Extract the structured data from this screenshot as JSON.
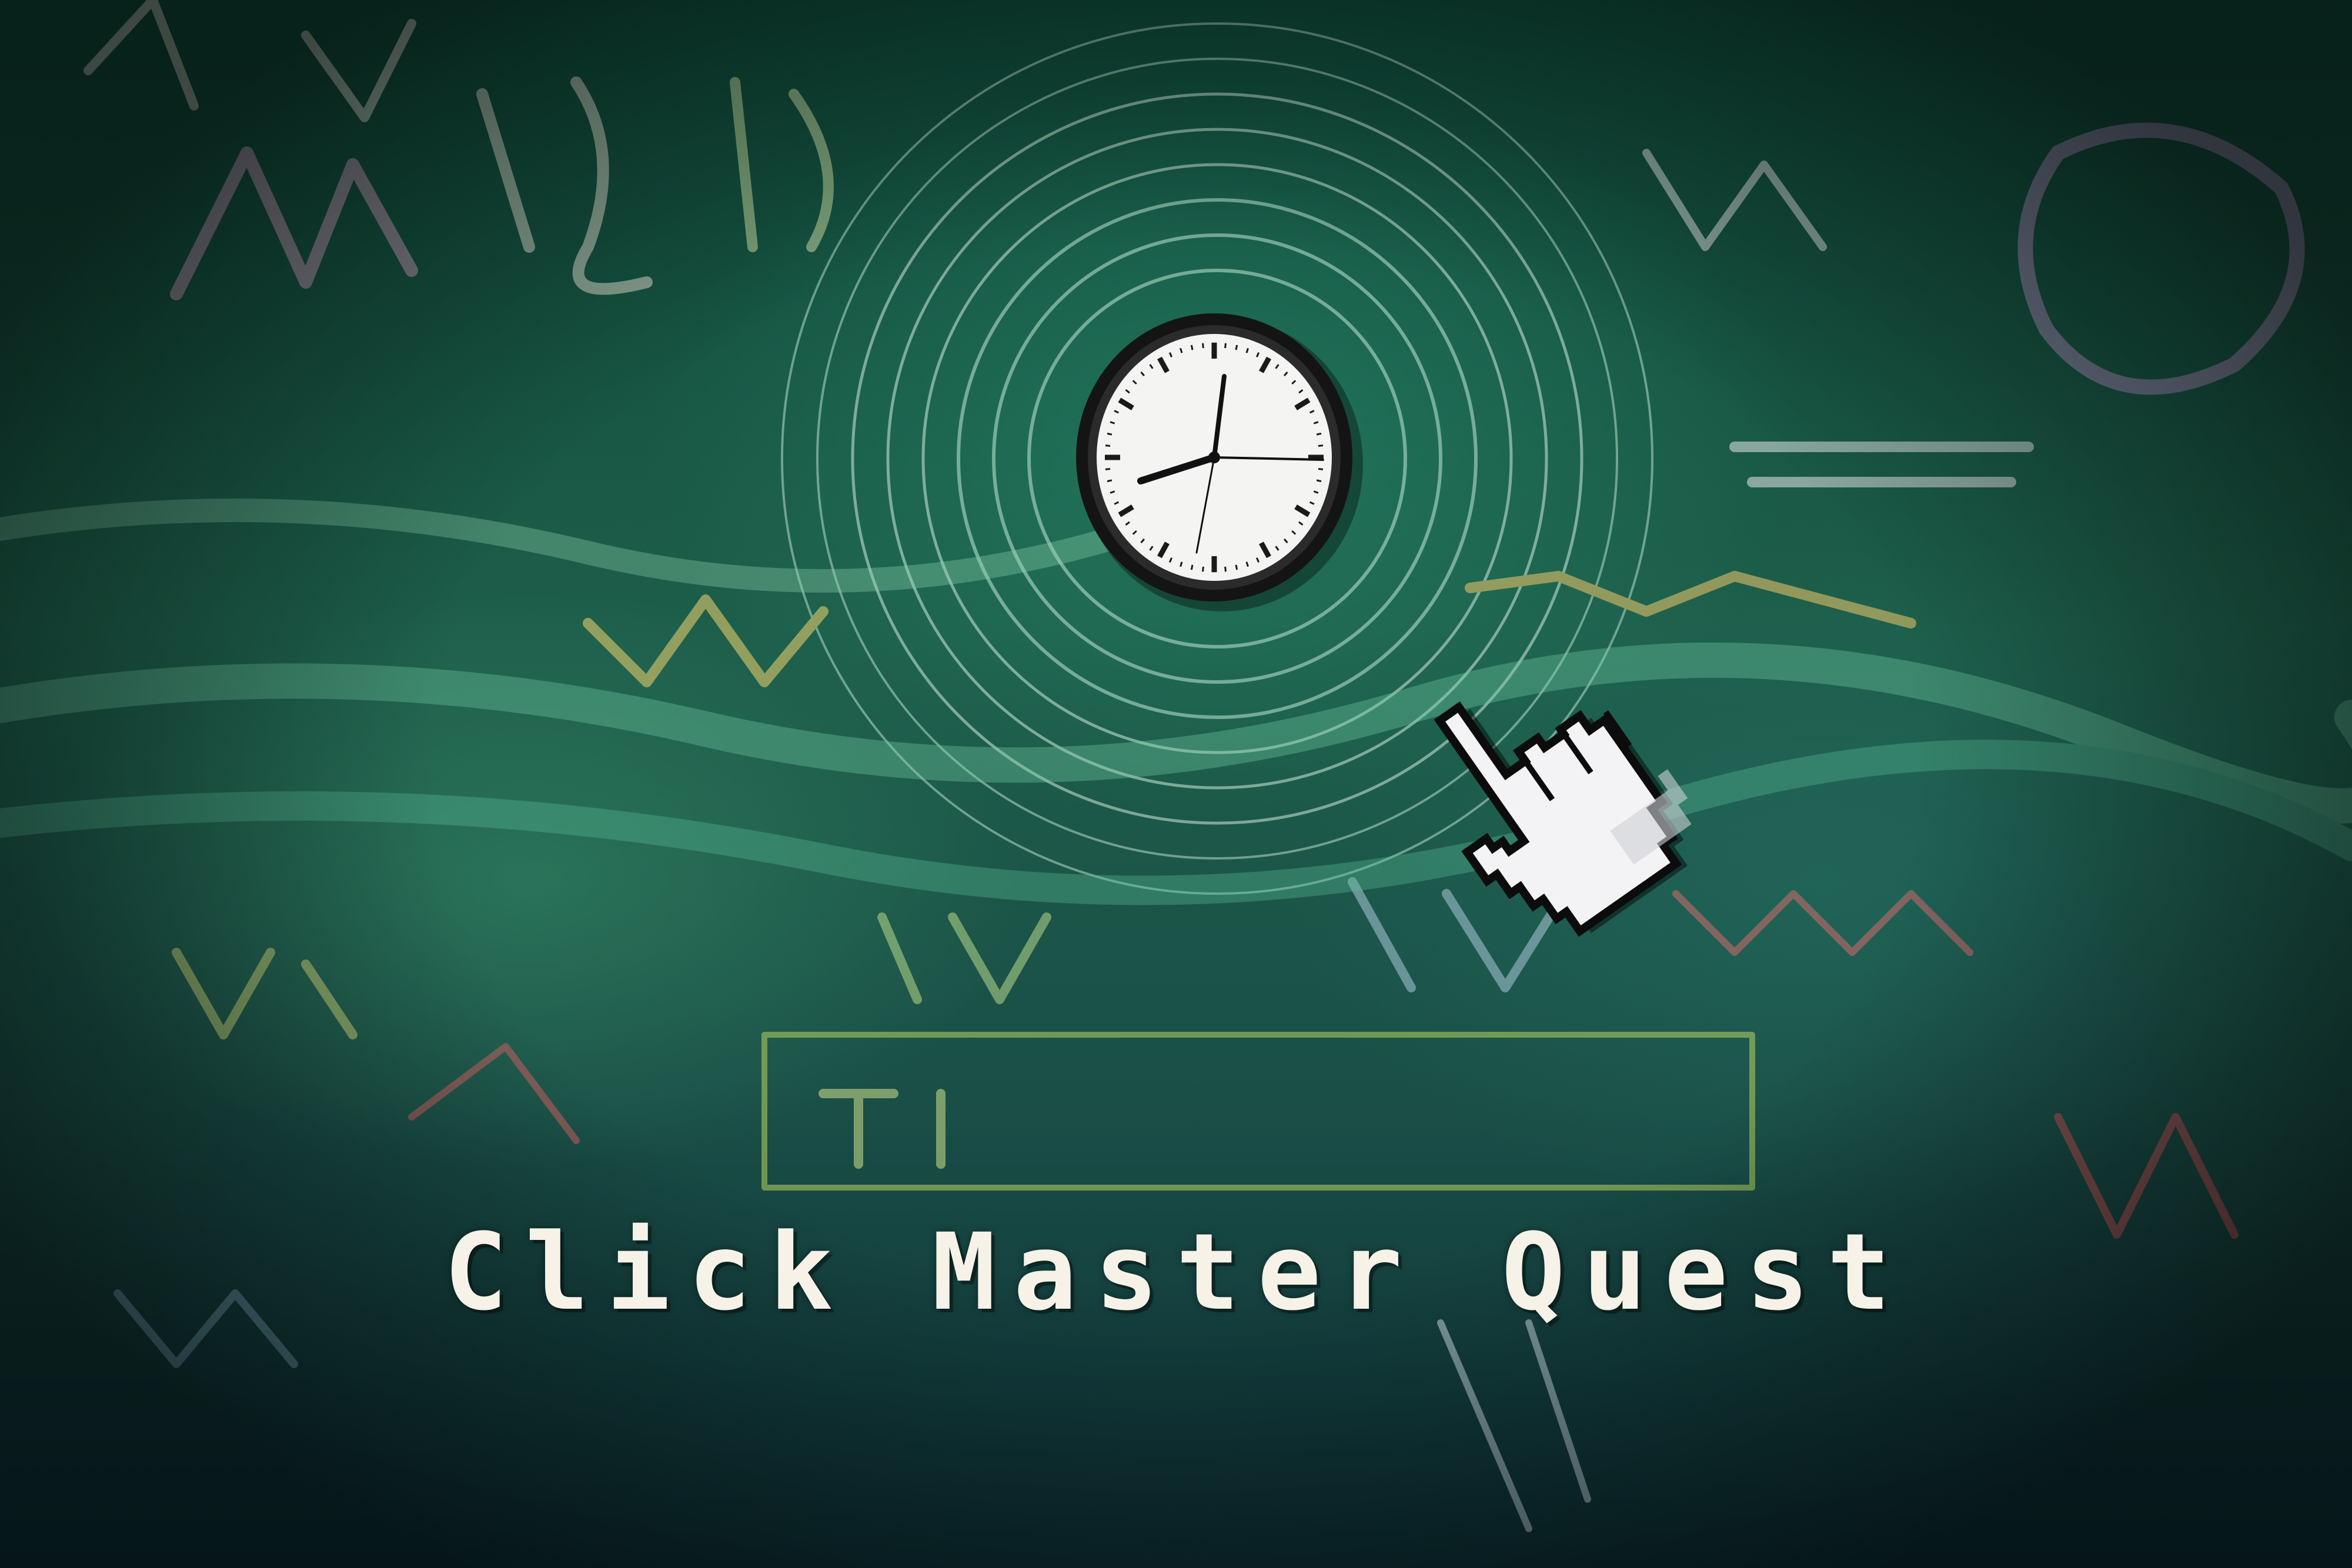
{
  "game": {
    "title": "Click Master Quest"
  },
  "icons": {
    "clock": "wall-clock-icon",
    "cursor": "hand-pointer-cursor-icon"
  },
  "colors": {
    "chalkboard": "#1d5e4a",
    "title_text": "#f6f2e8",
    "clock_face": "#f4f4f2",
    "clock_rim": "#1a1a1a"
  }
}
